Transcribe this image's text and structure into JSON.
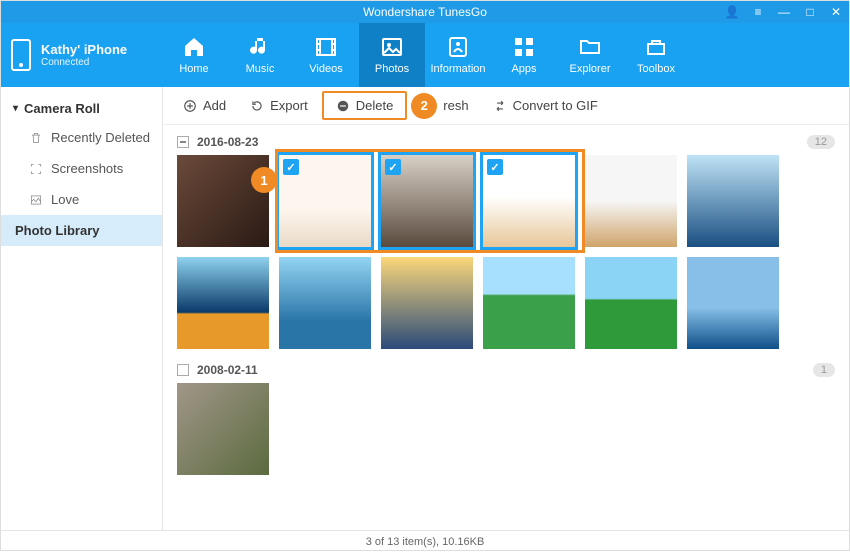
{
  "app": {
    "title": "Wondershare TunesGo"
  },
  "window": {
    "user_icon": "👤",
    "menu_icon": "≡",
    "min": "—",
    "max": "□",
    "close": "✕"
  },
  "device": {
    "name": "Kathy' iPhone",
    "status": "Connected"
  },
  "nav": {
    "home": "Home",
    "music": "Music",
    "videos": "Videos",
    "photos": "Photos",
    "information": "Information",
    "apps": "Apps",
    "explorer": "Explorer",
    "toolbox": "Toolbox"
  },
  "sidebar": {
    "group": "Camera Roll",
    "recently_deleted": "Recently Deleted",
    "screenshots": "Screenshots",
    "love": "Love",
    "photo_library": "Photo Library"
  },
  "toolbar": {
    "add": "Add",
    "export": "Export",
    "delete": "Delete",
    "refresh": "resh",
    "convert": "Convert to GIF"
  },
  "callouts": {
    "one": "1",
    "two": "2"
  },
  "sections": [
    {
      "date": "2016-08-23",
      "count": "12",
      "indeterminate": true,
      "photos": [
        {
          "sel": false
        },
        {
          "sel": true
        },
        {
          "sel": true
        },
        {
          "sel": true
        },
        {
          "sel": false
        },
        {
          "sel": false
        },
        {
          "sel": false
        },
        {
          "sel": false
        },
        {
          "sel": false
        },
        {
          "sel": false
        },
        {
          "sel": false
        },
        {
          "sel": false
        }
      ]
    },
    {
      "date": "2008-02-11",
      "count": "1",
      "indeterminate": false,
      "photos": [
        {
          "sel": false
        }
      ]
    }
  ],
  "status": "3 of 13 item(s), 10.16KB"
}
